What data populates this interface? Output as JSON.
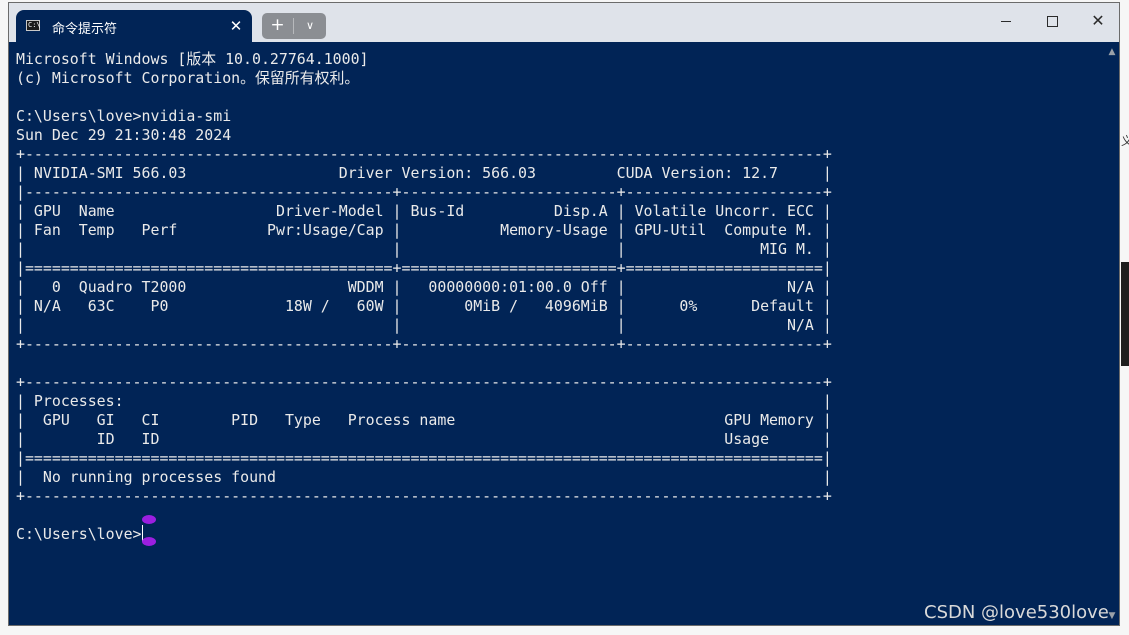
{
  "window": {
    "tab_title": "命令提示符",
    "tab_icon": "cmd-icon",
    "tab_close_glyph": "✕",
    "new_tab_glyph": "+",
    "dropdown_glyph": "∨",
    "close_glyph": "✕"
  },
  "console": {
    "lines": [
      "Microsoft Windows [版本 10.0.27764.1000]",
      "(c) Microsoft Corporation。保留所有权利。",
      "",
      "C:\\Users\\love>nvidia-smi",
      "Sun Dec 29 21:30:48 2024",
      "+-----------------------------------------------------------------------------------------+",
      "| NVIDIA-SMI 566.03                 Driver Version: 566.03         CUDA Version: 12.7     |",
      "|-----------------------------------------+------------------------+----------------------+",
      "| GPU  Name                  Driver-Model | Bus-Id          Disp.A | Volatile Uncorr. ECC |",
      "| Fan  Temp   Perf          Pwr:Usage/Cap |           Memory-Usage | GPU-Util  Compute M. |",
      "|                                         |                        |               MIG M. |",
      "|=========================================+========================+======================|",
      "|   0  Quadro T2000                  WDDM |   00000000:01:00.0 Off |                  N/A |",
      "| N/A   63C    P0             18W /   60W |       0MiB /   4096MiB |      0%      Default |",
      "|                                         |                        |                  N/A |",
      "+-----------------------------------------+------------------------+----------------------+",
      "",
      "+-----------------------------------------------------------------------------------------+",
      "| Processes:                                                                              |",
      "|  GPU   GI   CI        PID   Type   Process name                              GPU Memory |",
      "|        ID   ID                                                               Usage      |",
      "|=========================================================================================|",
      "|  No running processes found                                                             |",
      "+-----------------------------------------------------------------------------------------+",
      ""
    ],
    "prompt": "C:\\Users\\love>"
  },
  "scrollbar": {
    "up_glyph": "▲",
    "down_glyph": "▼"
  },
  "watermark": "CSDN @love530love",
  "edge_glyph": "义"
}
